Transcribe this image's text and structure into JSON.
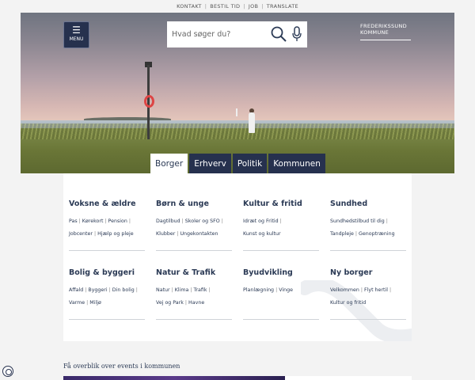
{
  "top_links": [
    "KONTAKT",
    "BESTIL TID",
    "JOB",
    "TRANSLATE"
  ],
  "menu": {
    "label": "MENU"
  },
  "search": {
    "placeholder": "Hvad søger du?"
  },
  "logo": {
    "line1": "FREDERIKSSUND",
    "line2": "KOMMUNE"
  },
  "tabs": [
    "Borger",
    "Erhverv",
    "Politik",
    "Kommunen"
  ],
  "active_tab": "Borger",
  "categories": [
    {
      "title": "Voksne & ældre",
      "links": [
        "Pas",
        "Kørekort",
        "Pension",
        "Jobcenter",
        "Hjælp og pleje"
      ]
    },
    {
      "title": "Børn & unge",
      "links": [
        "Dagtilbud",
        "Skoler og SFO",
        "Klubber",
        "Ungekontakten"
      ]
    },
    {
      "title": "Kultur & fritid",
      "links": [
        "Idræt og Fritid",
        "Kunst og kultur"
      ]
    },
    {
      "title": "Sundhed",
      "links": [
        "Sundhedstilbud til dig",
        "Tandpleje",
        "Genoptræning"
      ]
    },
    {
      "title": "Bolig & byggeri",
      "links": [
        "Affald",
        "Byggeri",
        "Din bolig",
        "Varme",
        "Miljø"
      ]
    },
    {
      "title": "Natur & Trafik",
      "links": [
        "Natur",
        "Klima",
        "Trafik",
        "Vej og Park",
        "Havne"
      ]
    },
    {
      "title": "Byudvikling",
      "links": [
        "Planlægning",
        "Vinge"
      ]
    },
    {
      "title": "Ny borger",
      "links": [
        "Velkommen",
        "Flyt hertil",
        "Kultur og fritid"
      ]
    }
  ],
  "events_heading": "Få overblik over events i kommunen",
  "icons": {
    "menu": "hamburger-icon",
    "search": "magnifier-icon",
    "mic": "microphone-icon",
    "cookie": "cookie-settings-icon"
  },
  "colors": {
    "navy": "#26314e",
    "text": "#2b3a55"
  }
}
